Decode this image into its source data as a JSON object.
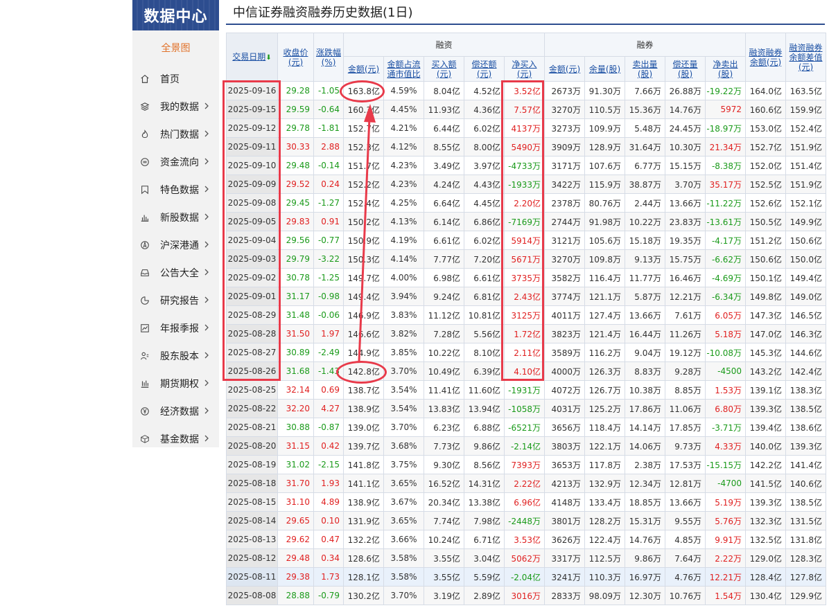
{
  "sidebar": {
    "brand": "数据中心",
    "overview": "全景图",
    "items": [
      {
        "label": "首页",
        "icon": "home-icon",
        "chevron": false
      },
      {
        "label": "我的数据",
        "icon": "layers-icon",
        "chevron": true
      },
      {
        "label": "热门数据",
        "icon": "flame-icon",
        "chevron": true
      },
      {
        "label": "资金流向",
        "icon": "exchange-icon",
        "chevron": true
      },
      {
        "label": "特色数据",
        "icon": "bookmark-icon",
        "chevron": true
      },
      {
        "label": "新股数据",
        "icon": "bar-chart-icon",
        "chevron": true
      },
      {
        "label": "沪深港通",
        "icon": "compass-icon",
        "chevron": true
      },
      {
        "label": "公告大全",
        "icon": "inbox-icon",
        "chevron": true
      },
      {
        "label": "研究报告",
        "icon": "pie-chart-icon",
        "chevron": true
      },
      {
        "label": "年报季报",
        "icon": "line-chart-icon",
        "chevron": true
      },
      {
        "label": "股东股本",
        "icon": "users-icon",
        "chevron": true
      },
      {
        "label": "期货期权",
        "icon": "candlestick-icon",
        "chevron": true
      },
      {
        "label": "经济数据",
        "icon": "yen-icon",
        "chevron": true
      },
      {
        "label": "基金数据",
        "icon": "box-icon",
        "chevron": true
      }
    ]
  },
  "page": {
    "title": "中信证券融资融券历史数据(1日)"
  },
  "table": {
    "group_rzi": "融资",
    "group_rq": "融券",
    "headers": {
      "date": "交易日期",
      "date_arrow": "⬇",
      "close_l1": "收盘价",
      "close_l2": "(元)",
      "chg_l1": "涨跌幅",
      "chg_l2": "(%)",
      "rz_amt": "金额(元)",
      "rz_ratio_l1": "金额占流",
      "rz_ratio_l2": "通市值比",
      "rz_buy_l1": "买入额",
      "rz_buy_l2": "(元)",
      "rz_repay_l1": "偿还额",
      "rz_repay_l2": "(元)",
      "rz_net_l1": "净买入",
      "rz_net_l2": "(元)",
      "rq_amt": "金额(元)",
      "rq_vol": "余量(股)",
      "rq_sell_l1": "卖出量",
      "rq_sell_l2": "(股)",
      "rq_repay_l1": "偿还量",
      "rq_repay_l2": "(股)",
      "rq_net_l1": "净卖出",
      "rq_net_l2": "(股)",
      "total_l1": "融资融券",
      "total_l2": "余额(元)",
      "diff_l1": "融资融券",
      "diff_l2": "余额差值",
      "diff_l3": "(元)"
    },
    "rows": [
      {
        "date": "2025-09-16",
        "close": "29.28",
        "chg": "-1.05",
        "rz_amt": "163.8亿",
        "rz_ratio": "4.59%",
        "rz_buy": "8.04亿",
        "rz_repay": "4.52亿",
        "rz_net": "3.52亿",
        "rq_amt": "2673万",
        "rq_vol": "91.30万",
        "rq_sell": "7.66万",
        "rq_repay": "26.88万",
        "rq_net": "-19.22万",
        "total": "164.0亿",
        "diff": "163.5亿"
      },
      {
        "date": "2025-09-15",
        "close": "29.59",
        "chg": "-0.64",
        "rz_amt": "160.3亿",
        "rz_ratio": "4.45%",
        "rz_buy": "11.93亿",
        "rz_repay": "4.36亿",
        "rz_net": "7.57亿",
        "rq_amt": "3270万",
        "rq_vol": "110.5万",
        "rq_sell": "15.36万",
        "rq_repay": "14.76万",
        "rq_net": "5972",
        "total": "160.6亿",
        "diff": "159.9亿"
      },
      {
        "date": "2025-09-12",
        "close": "29.78",
        "chg": "-1.81",
        "rz_amt": "152.7亿",
        "rz_ratio": "4.21%",
        "rz_buy": "6.44亿",
        "rz_repay": "6.02亿",
        "rz_net": "4137万",
        "rq_amt": "3273万",
        "rq_vol": "109.9万",
        "rq_sell": "5.48万",
        "rq_repay": "24.45万",
        "rq_net": "-18.97万",
        "total": "153.0亿",
        "diff": "152.4亿"
      },
      {
        "date": "2025-09-11",
        "close": "30.33",
        "chg": "2.88",
        "rz_amt": "152.3亿",
        "rz_ratio": "4.12%",
        "rz_buy": "8.55亿",
        "rz_repay": "8.00亿",
        "rz_net": "5490万",
        "rq_amt": "3909万",
        "rq_vol": "128.9万",
        "rq_sell": "31.64万",
        "rq_repay": "10.30万",
        "rq_net": "21.34万",
        "total": "152.7亿",
        "diff": "151.9亿"
      },
      {
        "date": "2025-09-10",
        "close": "29.48",
        "chg": "-0.14",
        "rz_amt": "151.7亿",
        "rz_ratio": "4.23%",
        "rz_buy": "3.49亿",
        "rz_repay": "3.97亿",
        "rz_net": "-4733万",
        "rq_amt": "3171万",
        "rq_vol": "107.6万",
        "rq_sell": "6.77万",
        "rq_repay": "15.15万",
        "rq_net": "-8.38万",
        "total": "152.0亿",
        "diff": "151.4亿"
      },
      {
        "date": "2025-09-09",
        "close": "29.52",
        "chg": "0.24",
        "rz_amt": "152.2亿",
        "rz_ratio": "4.23%",
        "rz_buy": "4.24亿",
        "rz_repay": "4.43亿",
        "rz_net": "-1933万",
        "rq_amt": "3422万",
        "rq_vol": "115.9万",
        "rq_sell": "38.87万",
        "rq_repay": "3.70万",
        "rq_net": "35.17万",
        "total": "152.5亿",
        "diff": "151.9亿"
      },
      {
        "date": "2025-09-08",
        "close": "29.45",
        "chg": "-1.27",
        "rz_amt": "152.4亿",
        "rz_ratio": "4.25%",
        "rz_buy": "6.64亿",
        "rz_repay": "4.45亿",
        "rz_net": "2.20亿",
        "rq_amt": "2378万",
        "rq_vol": "80.76万",
        "rq_sell": "2.44万",
        "rq_repay": "13.66万",
        "rq_net": "-11.22万",
        "total": "152.6亿",
        "diff": "152.1亿"
      },
      {
        "date": "2025-09-05",
        "close": "29.83",
        "chg": "0.91",
        "rz_amt": "150.2亿",
        "rz_ratio": "4.13%",
        "rz_buy": "6.14亿",
        "rz_repay": "6.86亿",
        "rz_net": "-7169万",
        "rq_amt": "2744万",
        "rq_vol": "91.98万",
        "rq_sell": "10.22万",
        "rq_repay": "23.83万",
        "rq_net": "-13.61万",
        "total": "150.5亿",
        "diff": "149.9亿"
      },
      {
        "date": "2025-09-04",
        "close": "29.56",
        "chg": "-0.77",
        "rz_amt": "150.9亿",
        "rz_ratio": "4.19%",
        "rz_buy": "6.61亿",
        "rz_repay": "6.02亿",
        "rz_net": "5914万",
        "rq_amt": "3121万",
        "rq_vol": "105.6万",
        "rq_sell": "15.18万",
        "rq_repay": "19.35万",
        "rq_net": "-4.17万",
        "total": "151.2亿",
        "diff": "150.6亿"
      },
      {
        "date": "2025-09-03",
        "close": "29.79",
        "chg": "-3.22",
        "rz_amt": "150.3亿",
        "rz_ratio": "4.14%",
        "rz_buy": "7.77亿",
        "rz_repay": "7.20亿",
        "rz_net": "5671万",
        "rq_amt": "3270万",
        "rq_vol": "109.8万",
        "rq_sell": "9.13万",
        "rq_repay": "15.75万",
        "rq_net": "-6.62万",
        "total": "150.6亿",
        "diff": "150.0亿"
      },
      {
        "date": "2025-09-02",
        "close": "30.78",
        "chg": "-1.25",
        "rz_amt": "149.7亿",
        "rz_ratio": "4.00%",
        "rz_buy": "6.98亿",
        "rz_repay": "6.61亿",
        "rz_net": "3735万",
        "rq_amt": "3582万",
        "rq_vol": "116.4万",
        "rq_sell": "11.77万",
        "rq_repay": "16.46万",
        "rq_net": "-4.69万",
        "total": "150.1亿",
        "diff": "149.4亿"
      },
      {
        "date": "2025-09-01",
        "close": "31.17",
        "chg": "-0.98",
        "rz_amt": "149.4亿",
        "rz_ratio": "3.94%",
        "rz_buy": "9.24亿",
        "rz_repay": "6.81亿",
        "rz_net": "2.43亿",
        "rq_amt": "3774万",
        "rq_vol": "121.1万",
        "rq_sell": "5.87万",
        "rq_repay": "12.21万",
        "rq_net": "-6.34万",
        "total": "149.8亿",
        "diff": "149.0亿"
      },
      {
        "date": "2025-08-29",
        "close": "31.48",
        "chg": "-0.06",
        "rz_amt": "146.9亿",
        "rz_ratio": "3.83%",
        "rz_buy": "11.12亿",
        "rz_repay": "10.81亿",
        "rz_net": "3125万",
        "rq_amt": "4011万",
        "rq_vol": "127.4万",
        "rq_sell": "13.66万",
        "rq_repay": "7.61万",
        "rq_net": "6.05万",
        "total": "147.3亿",
        "diff": "146.5亿"
      },
      {
        "date": "2025-08-28",
        "close": "31.50",
        "chg": "1.97",
        "rz_amt": "146.6亿",
        "rz_ratio": "3.82%",
        "rz_buy": "7.28亿",
        "rz_repay": "5.56亿",
        "rz_net": "1.72亿",
        "rq_amt": "3823万",
        "rq_vol": "121.4万",
        "rq_sell": "16.44万",
        "rq_repay": "11.26万",
        "rq_net": "5.18万",
        "total": "147.0亿",
        "diff": "146.3亿"
      },
      {
        "date": "2025-08-27",
        "close": "30.89",
        "chg": "-2.49",
        "rz_amt": "144.9亿",
        "rz_ratio": "3.85%",
        "rz_buy": "10.22亿",
        "rz_repay": "8.10亿",
        "rz_net": "2.11亿",
        "rq_amt": "3589万",
        "rq_vol": "116.2万",
        "rq_sell": "9.04万",
        "rq_repay": "19.12万",
        "rq_net": "-10.08万",
        "total": "145.3亿",
        "diff": "144.6亿"
      },
      {
        "date": "2025-08-26",
        "close": "31.68",
        "chg": "-1.43",
        "rz_amt": "142.8亿",
        "rz_ratio": "3.70%",
        "rz_buy": "10.49亿",
        "rz_repay": "6.39亿",
        "rz_net": "4.10亿",
        "rq_amt": "4000万",
        "rq_vol": "126.3万",
        "rq_sell": "8.83万",
        "rq_repay": "9.28万",
        "rq_net": "-4500",
        "total": "143.2亿",
        "diff": "142.4亿"
      },
      {
        "date": "2025-08-25",
        "close": "32.14",
        "chg": "0.69",
        "rz_amt": "138.7亿",
        "rz_ratio": "3.54%",
        "rz_buy": "11.41亿",
        "rz_repay": "11.60亿",
        "rz_net": "-1931万",
        "rq_amt": "4072万",
        "rq_vol": "126.7万",
        "rq_sell": "10.38万",
        "rq_repay": "8.85万",
        "rq_net": "1.53万",
        "total": "139.1亿",
        "diff": "138.3亿"
      },
      {
        "date": "2025-08-22",
        "close": "32.20",
        "chg": "4.27",
        "rz_amt": "138.9亿",
        "rz_ratio": "3.54%",
        "rz_buy": "13.83亿",
        "rz_repay": "13.94亿",
        "rz_net": "-1058万",
        "rq_amt": "4031万",
        "rq_vol": "125.2万",
        "rq_sell": "17.86万",
        "rq_repay": "11.06万",
        "rq_net": "6.80万",
        "total": "139.3亿",
        "diff": "138.5亿"
      },
      {
        "date": "2025-08-21",
        "close": "30.88",
        "chg": "-0.87",
        "rz_amt": "139.0亿",
        "rz_ratio": "3.70%",
        "rz_buy": "6.23亿",
        "rz_repay": "6.88亿",
        "rz_net": "-6521万",
        "rq_amt": "3656万",
        "rq_vol": "118.4万",
        "rq_sell": "14.14万",
        "rq_repay": "17.85万",
        "rq_net": "-3.71万",
        "total": "139.4亿",
        "diff": "138.6亿"
      },
      {
        "date": "2025-08-20",
        "close": "31.15",
        "chg": "0.42",
        "rz_amt": "139.7亿",
        "rz_ratio": "3.68%",
        "rz_buy": "7.73亿",
        "rz_repay": "9.86亿",
        "rz_net": "-2.14亿",
        "rq_amt": "3803万",
        "rq_vol": "122.1万",
        "rq_sell": "14.06万",
        "rq_repay": "9.73万",
        "rq_net": "4.33万",
        "total": "140.0亿",
        "diff": "139.3亿"
      },
      {
        "date": "2025-08-19",
        "close": "31.02",
        "chg": "-2.15",
        "rz_amt": "141.8亿",
        "rz_ratio": "3.75%",
        "rz_buy": "9.30亿",
        "rz_repay": "8.56亿",
        "rz_net": "7393万",
        "rq_amt": "3653万",
        "rq_vol": "117.8万",
        "rq_sell": "2.38万",
        "rq_repay": "17.53万",
        "rq_net": "-15.15万",
        "total": "142.2亿",
        "diff": "141.4亿"
      },
      {
        "date": "2025-08-18",
        "close": "31.70",
        "chg": "1.93",
        "rz_amt": "141.1亿",
        "rz_ratio": "3.65%",
        "rz_buy": "16.52亿",
        "rz_repay": "14.31亿",
        "rz_net": "2.22亿",
        "rq_amt": "4213万",
        "rq_vol": "132.9万",
        "rq_sell": "12.34万",
        "rq_repay": "12.81万",
        "rq_net": "-4700",
        "total": "141.5亿",
        "diff": "140.6亿"
      },
      {
        "date": "2025-08-15",
        "close": "31.10",
        "chg": "4.89",
        "rz_amt": "138.9亿",
        "rz_ratio": "3.67%",
        "rz_buy": "20.34亿",
        "rz_repay": "13.38亿",
        "rz_net": "6.96亿",
        "rq_amt": "4148万",
        "rq_vol": "133.4万",
        "rq_sell": "18.85万",
        "rq_repay": "13.66万",
        "rq_net": "5.19万",
        "total": "139.3亿",
        "diff": "138.5亿"
      },
      {
        "date": "2025-08-14",
        "close": "29.65",
        "chg": "0.10",
        "rz_amt": "131.9亿",
        "rz_ratio": "3.65%",
        "rz_buy": "7.74亿",
        "rz_repay": "7.98亿",
        "rz_net": "-2448万",
        "rq_amt": "3801万",
        "rq_vol": "128.2万",
        "rq_sell": "15.31万",
        "rq_repay": "9.55万",
        "rq_net": "5.76万",
        "total": "132.3亿",
        "diff": "131.5亿"
      },
      {
        "date": "2025-08-13",
        "close": "29.62",
        "chg": "0.47",
        "rz_amt": "132.2亿",
        "rz_ratio": "3.66%",
        "rz_buy": "10.24亿",
        "rz_repay": "6.71亿",
        "rz_net": "3.53亿",
        "rq_amt": "3626万",
        "rq_vol": "122.4万",
        "rq_sell": "14.76万",
        "rq_repay": "4.85万",
        "rq_net": "9.91万",
        "total": "132.5亿",
        "diff": "131.8亿"
      },
      {
        "date": "2025-08-12",
        "close": "29.48",
        "chg": "0.34",
        "rz_amt": "128.6亿",
        "rz_ratio": "3.58%",
        "rz_buy": "3.55亿",
        "rz_repay": "3.04亿",
        "rz_net": "5062万",
        "rq_amt": "3317万",
        "rq_vol": "112.5万",
        "rq_sell": "9.86万",
        "rq_repay": "7.64万",
        "rq_net": "2.22万",
        "total": "129.0亿",
        "diff": "128.3亿"
      },
      {
        "date": "2025-08-11",
        "close": "29.38",
        "chg": "1.73",
        "rz_amt": "128.1亿",
        "rz_ratio": "3.58%",
        "rz_buy": "3.55亿",
        "rz_repay": "5.59亿",
        "rz_net": "-2.04亿",
        "rq_amt": "3241万",
        "rq_vol": "110.3万",
        "rq_sell": "16.97万",
        "rq_repay": "4.76万",
        "rq_net": "12.21万",
        "total": "128.4亿",
        "diff": "127.8亿"
      },
      {
        "date": "2025-08-08",
        "close": "28.88",
        "chg": "-0.79",
        "rz_amt": "130.2亿",
        "rz_ratio": "3.70%",
        "rz_buy": "3.19亿",
        "rz_repay": "2.89亿",
        "rz_net": "3016万",
        "rq_amt": "2833万",
        "rq_vol": "98.09万",
        "rq_sell": "12.30万",
        "rq_repay": "10.76万",
        "rq_net": "1.54万",
        "total": "130.4亿",
        "diff": "129.9亿"
      }
    ]
  },
  "colors": {
    "up": "#e02020",
    "down": "#1a9a1a",
    "brand": "#2d4d8f",
    "annotation": "#e83a4a"
  }
}
